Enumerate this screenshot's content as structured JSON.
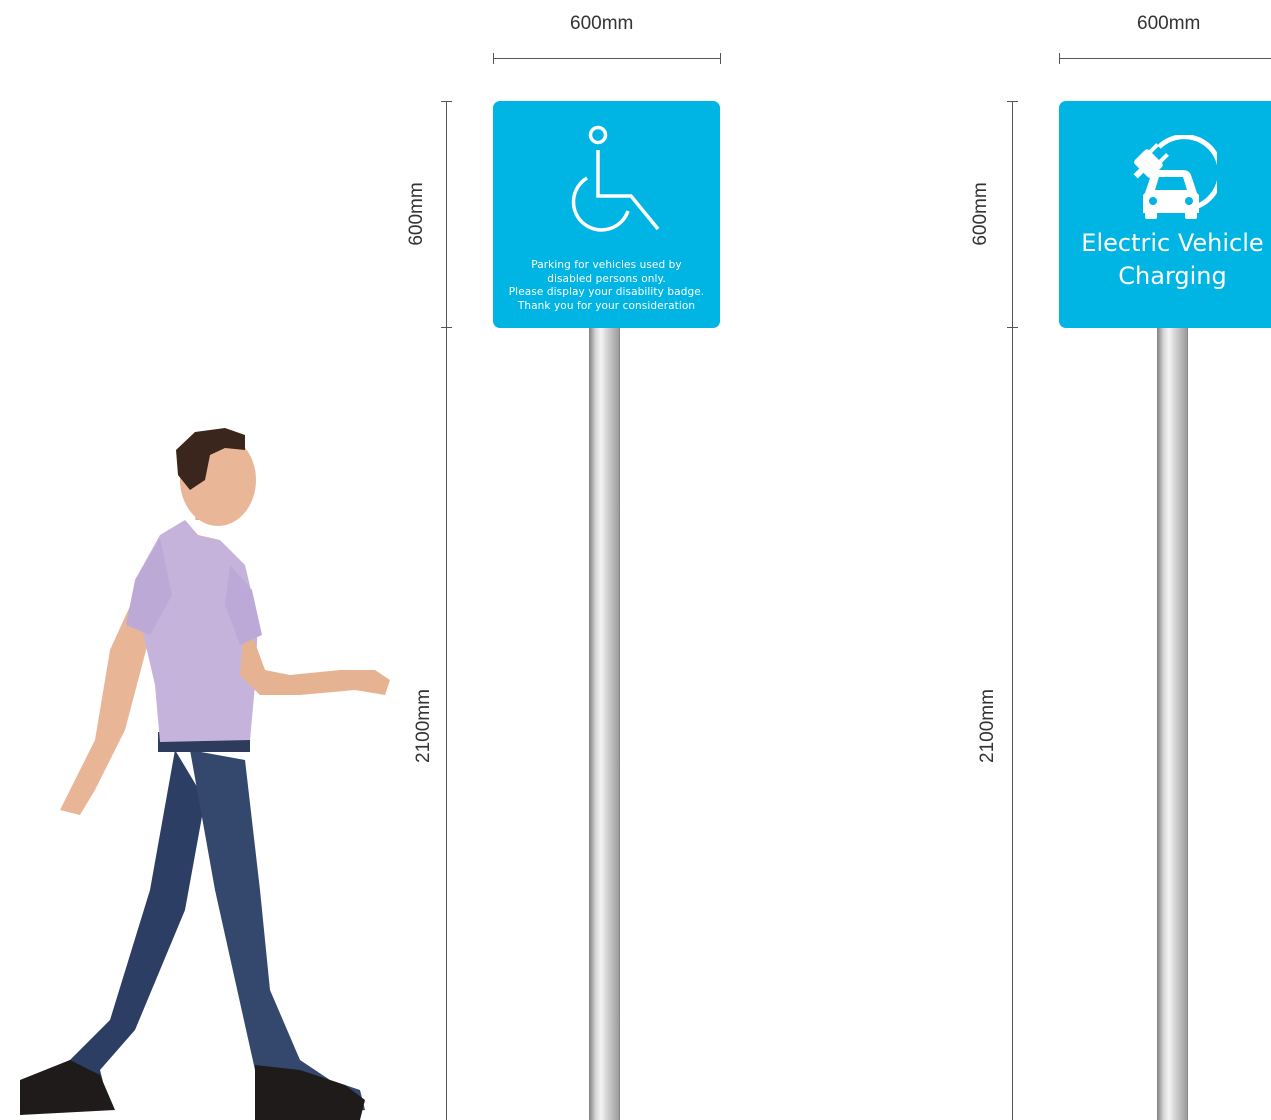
{
  "left_group": {
    "width_label": "600mm",
    "sign_height_label": "600mm",
    "pole_height_label": "2100mm",
    "sign": {
      "icon": "wheelchair-icon",
      "lines": [
        "Parking for vehicles used by",
        "disabled persons only.",
        "Please display your disability badge.",
        "Thank you for your consideration"
      ]
    }
  },
  "right_group": {
    "width_label": "600mm",
    "sign_height_label": "600mm",
    "pole_height_label": "2100mm",
    "sign": {
      "icon": "ev-charging-car-icon",
      "title_line1": "Electric Vehicle",
      "title_line2": "Charging"
    }
  },
  "colors": {
    "sign_blue": "#00b4e4",
    "dimension_line": "#555555"
  },
  "figure": "walking-man-figure"
}
